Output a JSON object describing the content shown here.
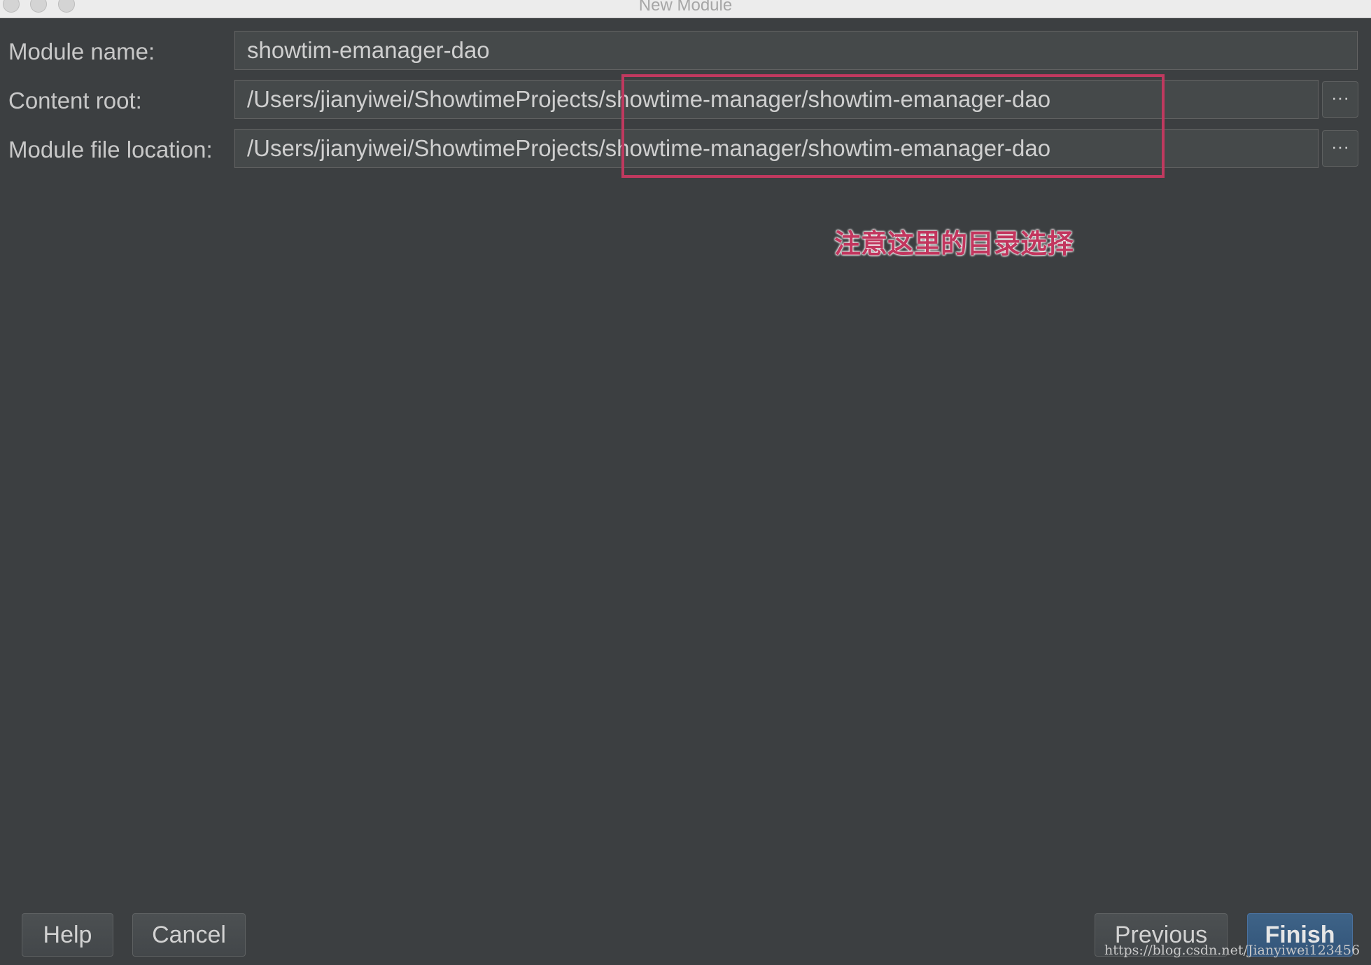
{
  "window": {
    "title": "New Module"
  },
  "form": {
    "module_name": {
      "label": "Module name:",
      "value": "showtim-emanager-dao"
    },
    "content_root": {
      "label": "Content root:",
      "value": "/Users/jianyiwei/ShowtimeProjects/showtime-manager/showtim-emanager-dao",
      "browse_label": "···"
    },
    "module_file_location": {
      "label": "Module file location:",
      "value": "/Users/jianyiwei/ShowtimeProjects/showtime-manager/showtim-emanager-dao",
      "browse_label": "···"
    }
  },
  "annotation": {
    "text": "注意这里的目录选择",
    "color": "#c0395f"
  },
  "buttons": {
    "help": "Help",
    "cancel": "Cancel",
    "previous": "Previous",
    "finish": "Finish"
  },
  "watermark": "https://blog.csdn.net/Jianyiwei123456",
  "colors": {
    "background": "#3c3f41",
    "field_background": "#45494a",
    "primary_button": "#365880",
    "annotation": "#c0395f"
  }
}
